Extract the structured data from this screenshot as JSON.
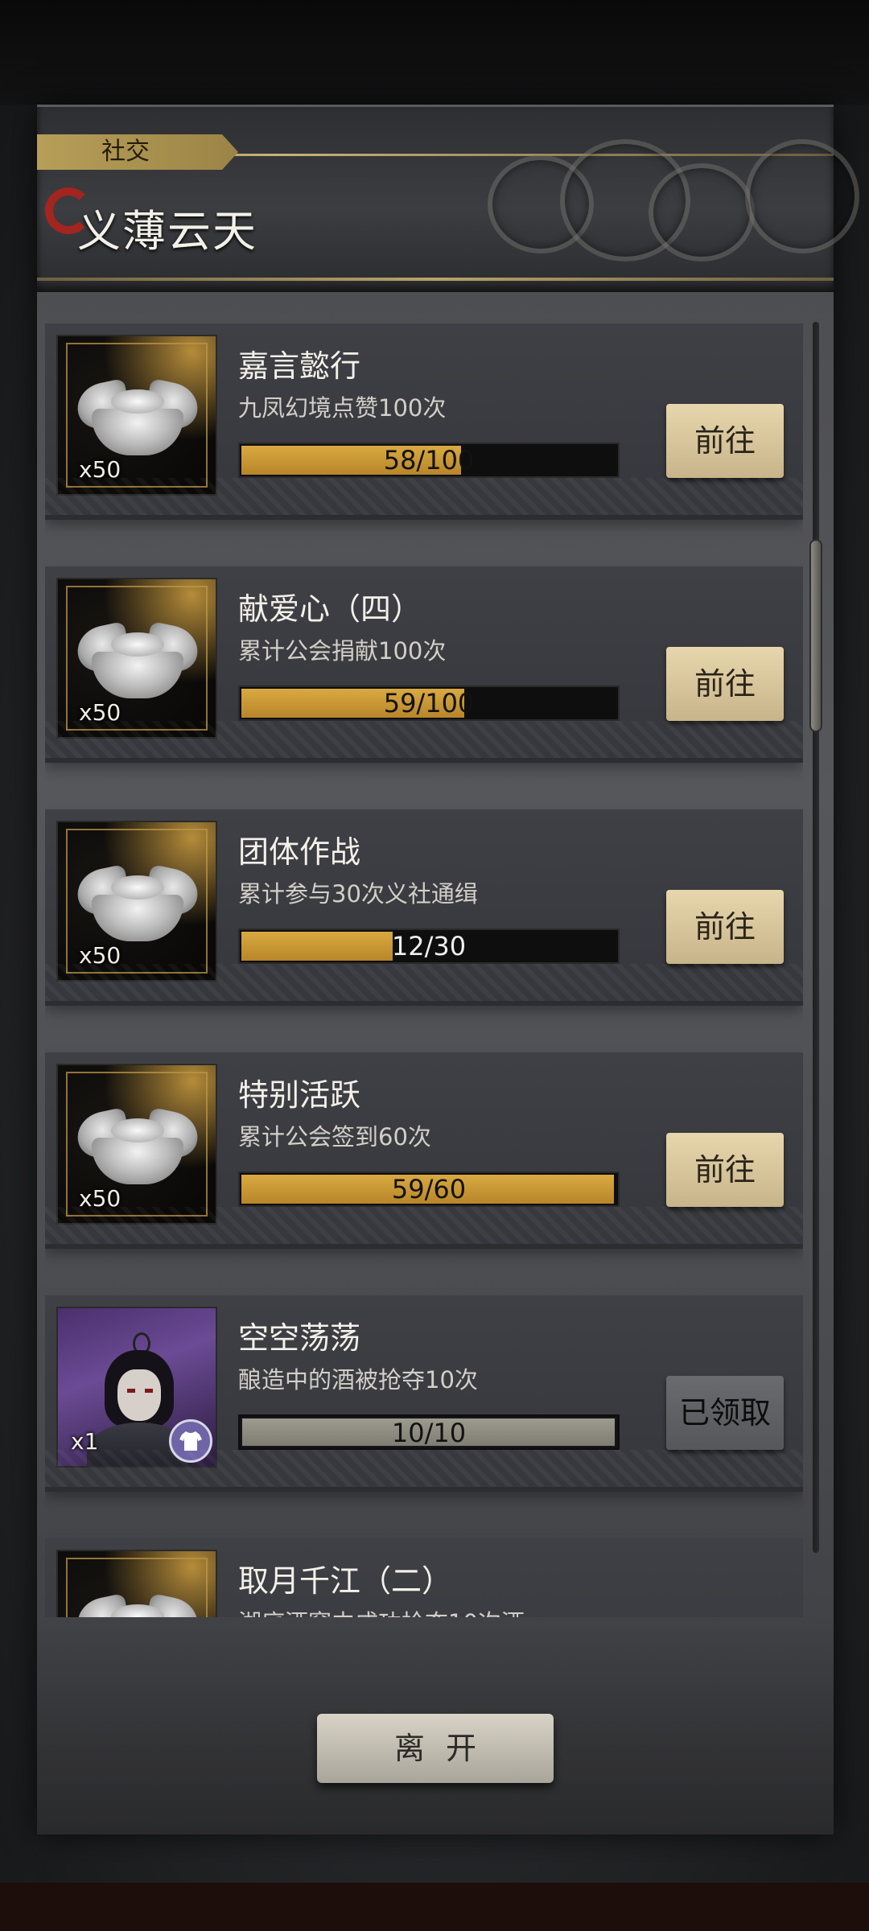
{
  "header": {
    "tag": "社交",
    "title": "义薄云天"
  },
  "tasks": [
    {
      "title": "嘉言懿行",
      "desc": "九凤幻境点赞100次",
      "progress_text": "58/100",
      "progress_fraction": 0.58,
      "reward_qty": "x50",
      "reward_icon": "silver-ingot-icon",
      "action": "前往"
    },
    {
      "title": "献爱心（四）",
      "desc": "累计公会捐献100次",
      "progress_text": "59/100",
      "progress_fraction": 0.59,
      "reward_qty": "x50",
      "reward_icon": "silver-ingot-icon",
      "action": "前往"
    },
    {
      "title": "团体作战",
      "desc": "累计参与30次义社通缉",
      "progress_text": "12/30",
      "progress_fraction": 0.4,
      "reward_qty": "x50",
      "reward_icon": "silver-ingot-icon",
      "action": "前往"
    },
    {
      "title": "特别活跃",
      "desc": "累计公会签到60次",
      "progress_text": "59/60",
      "progress_fraction": 0.983,
      "reward_qty": "x50",
      "reward_icon": "silver-ingot-icon",
      "action": "前往"
    },
    {
      "title": "空空荡荡",
      "desc": "酿造中的酒被抢夺10次",
      "progress_text": "10/10",
      "progress_fraction": 1.0,
      "reward_qty": "x1",
      "reward_icon": "character-outfit-icon",
      "action": "已领取"
    },
    {
      "title": "取月千江（二）",
      "desc": "湖底酒窖中成功抢夺10次酒",
      "reward_icon": "silver-ingot-icon"
    }
  ],
  "footer": {
    "leave_label": "离开"
  },
  "colors": {
    "progress_fill": "#d9a941",
    "progress_done": "#9d9a8e",
    "button_bg": "#e7d6ad",
    "tag_bg": "#b79e58",
    "title_swirl": "#a4251f"
  }
}
